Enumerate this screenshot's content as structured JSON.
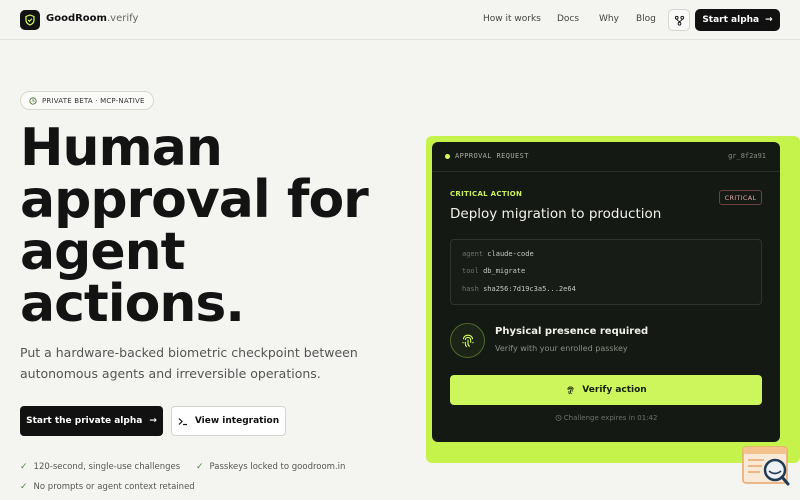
{
  "nav": {
    "brand_bold": "GoodRoom",
    "brand_light": ".verify",
    "links": [
      "How it works",
      "Docs",
      "Why",
      "Blog"
    ],
    "cta": "Start alpha",
    "cta_arrow": "→",
    "icon": "git-branch-icon"
  },
  "hero": {
    "pill": "PRIVATE BETA · MCP-NATIVE",
    "headline": [
      "Human",
      "approval for",
      "agent",
      "actions."
    ],
    "sub": "Put a hardware-backed biometric checkpoint between autonomous agents and irreversible operations.",
    "primary_btn": "Start the private alpha",
    "primary_arrow": "→",
    "secondary_btn": "View integration",
    "secondary_icon": ">_",
    "checks": [
      "120-second, single-use challenges",
      "Passkeys locked to goodroom.in",
      "No prompts or agent context retained"
    ]
  },
  "card": {
    "header_label": "APPROVAL REQUEST",
    "header_id": "gr_8f2a91",
    "critical_label": "CRITICAL ACTION",
    "critical_badge": "CRITICAL",
    "title": "Deploy migration to production",
    "meta": [
      {
        "key": "agent",
        "value": "claude-code"
      },
      {
        "key": "tool",
        "value": "db_migrate"
      },
      {
        "key": "hash",
        "value": "sha256:7d19c3a5...2e64"
      }
    ],
    "presence_title": "Physical presence required",
    "presence_sub": "Verify with your enrolled passkey",
    "verify_btn": "Verify action",
    "expires": "Challenge expires in 01:42"
  },
  "colors": {
    "accent": "#cdf55c",
    "card_bg": "#141914",
    "page_bg": "#f4f4f1",
    "dark": "#111111"
  }
}
